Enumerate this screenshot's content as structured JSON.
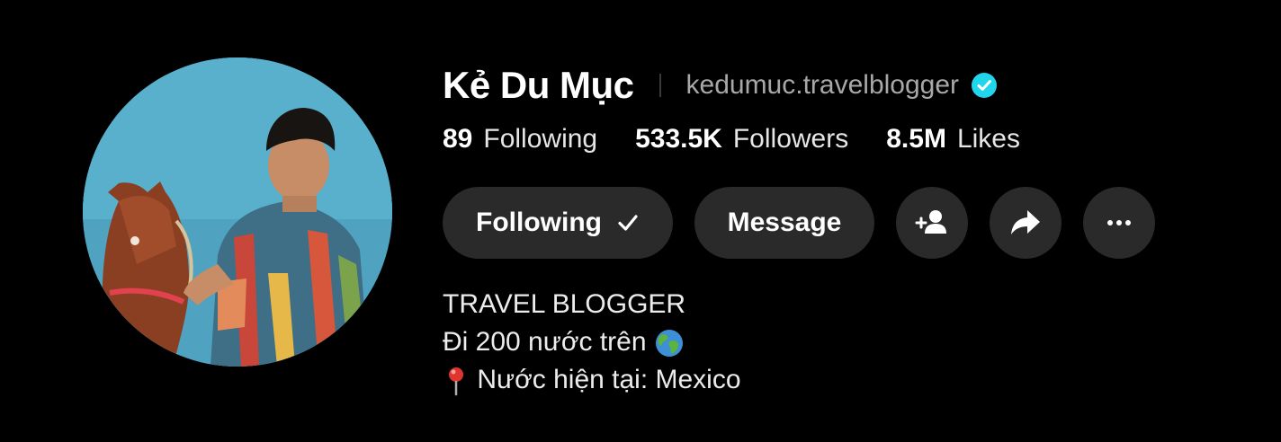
{
  "profile": {
    "display_name": "Kẻ Du Mục",
    "handle": "kedumuc.travelblogger",
    "verified": true
  },
  "stats": [
    {
      "value": "89",
      "label": "Following"
    },
    {
      "value": "533.5K",
      "label": "Followers"
    },
    {
      "value": "8.5M",
      "label": "Likes"
    }
  ],
  "actions": {
    "following_label": "Following",
    "message_label": "Message",
    "add_friend_icon": "add-friend-icon",
    "share_icon": "share-icon",
    "more_icon": "more-icon"
  },
  "bio": {
    "line1": "TRAVEL BLOGGER",
    "line2": "Đi 200 nước trên",
    "line3": "Nước hiện tại: Mexico"
  },
  "colors": {
    "background": "#000000",
    "button": "#2a2a2a",
    "verified": "#20d5ec",
    "handle": "#a8a8a8"
  }
}
